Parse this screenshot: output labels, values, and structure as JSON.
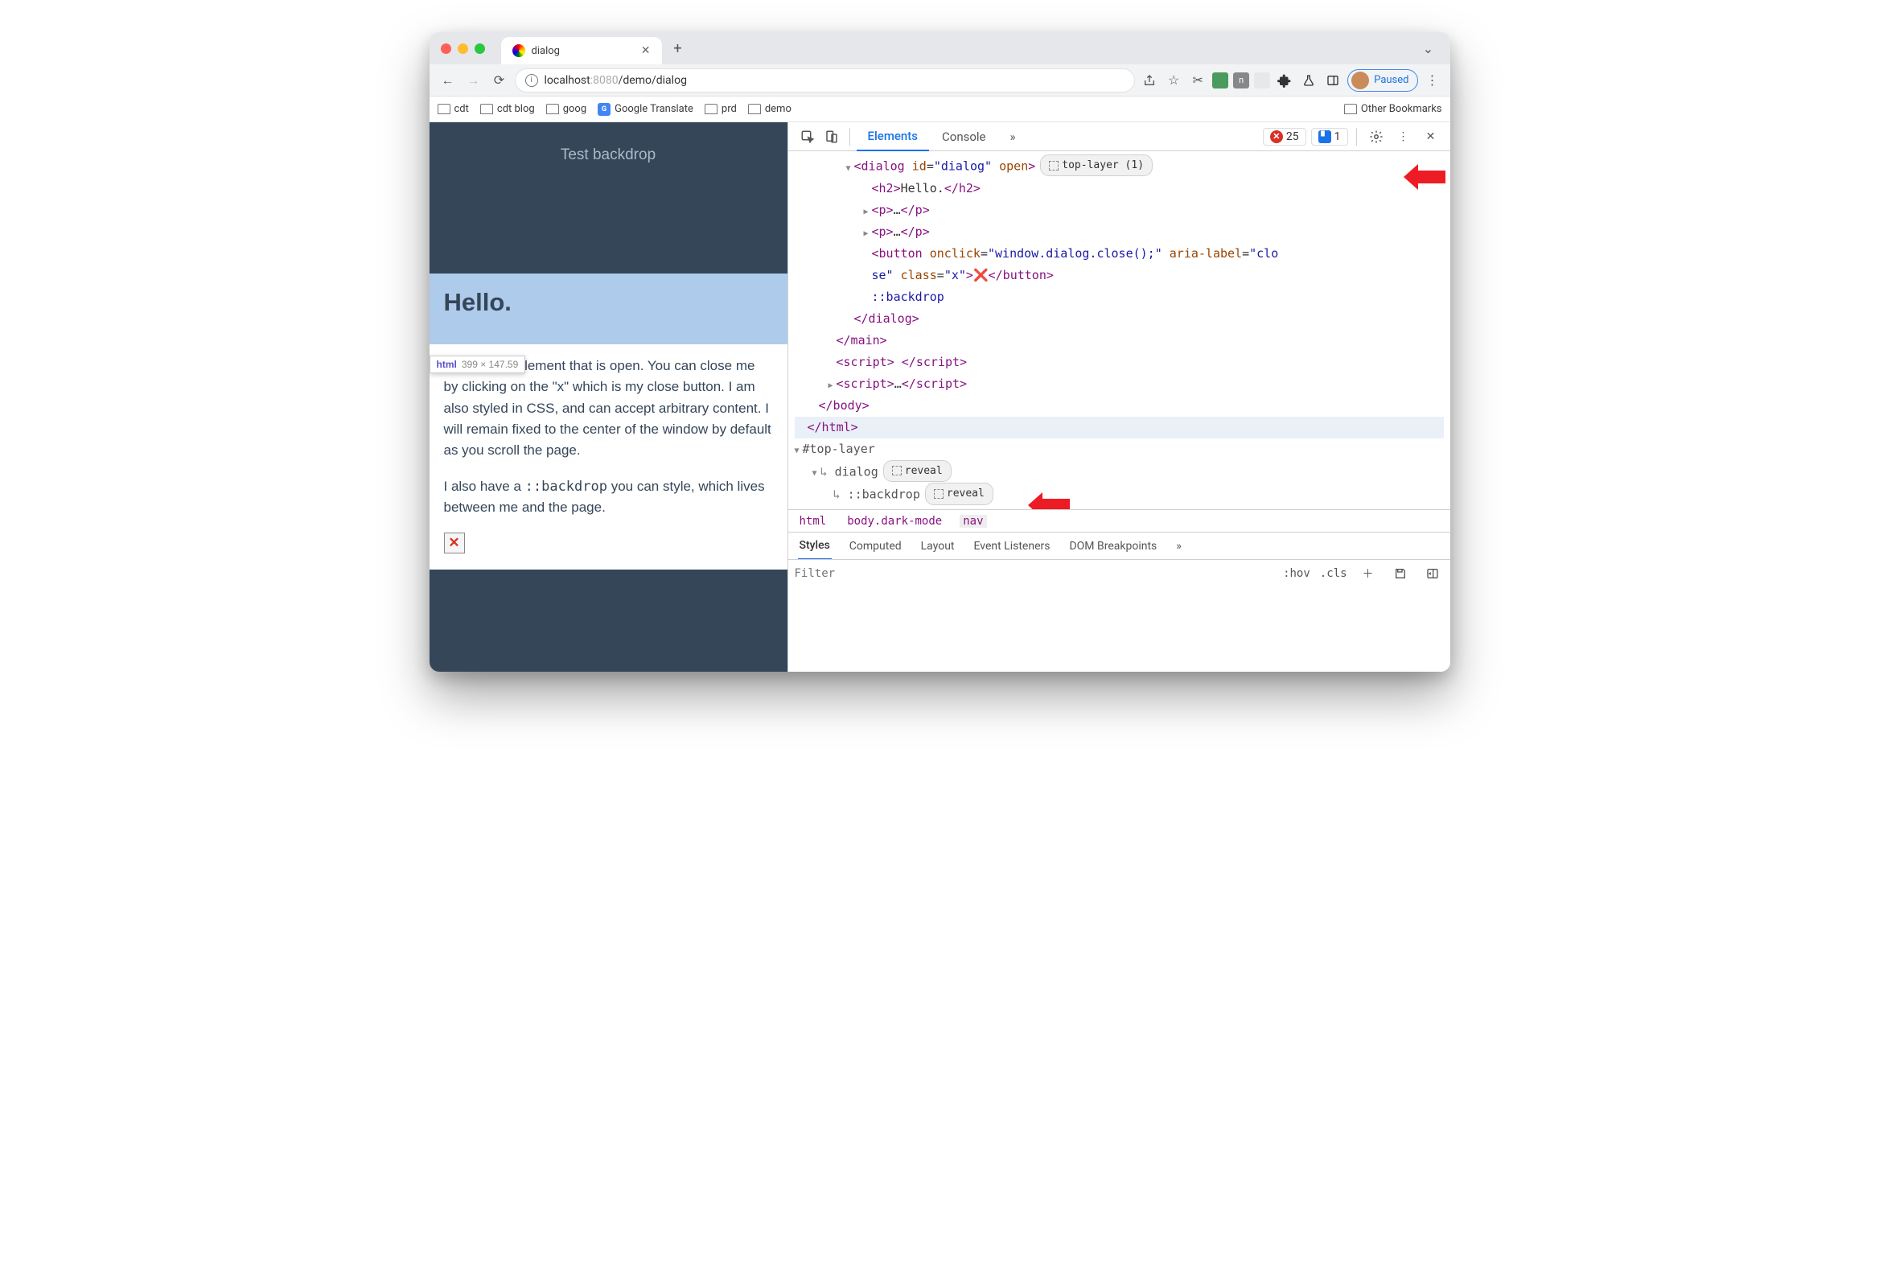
{
  "tab": {
    "title": "dialog"
  },
  "address": {
    "host_plain1": "localhost",
    "host_gray": ":8080",
    "path": "/demo/dialog"
  },
  "profile_label": "Paused",
  "bookmarks": {
    "items": [
      "cdt",
      "cdt blog",
      "goog",
      "Google Translate",
      "prd",
      "demo"
    ],
    "other": "Other Bookmarks"
  },
  "page": {
    "button": "Test backdrop",
    "heading": "Hello.",
    "tooltip_tag": "html",
    "tooltip_dim": "399 × 147.59",
    "para1": "I'm a dialog element that is open. You can close me by clicking on the \"x\" which is my close button. I am also styled in CSS, and can accept arbitrary content. I will remain fixed to the center of the window by default as you scroll the page.",
    "para2_a": "I also have a ",
    "para2_code": "::backdrop",
    "para2_b": " you can style, which lives between me and the page.",
    "xbtn": "✕"
  },
  "devtools": {
    "tabs": {
      "elements": "Elements",
      "console": "Console",
      "more": "»"
    },
    "err_count": "25",
    "info_count": "1",
    "tree": {
      "dialog_open": "<dialog id=\"dialog\" open>",
      "top_layer_badge": "top-layer (1)",
      "h2": "<h2>Hello.</h2>",
      "p_collapsed": "<p>…</p>",
      "button_line1": "<button onclick=\"window.dialog.close();\" aria-label=\"clo",
      "button_line2": "se\" class=\"x\">❌</button>",
      "backdrop": "::backdrop",
      "dialog_close": "</dialog>",
      "main_close": "</main>",
      "script_empty": "<script> </script>",
      "script_collapsed": "<script>…</script>",
      "body_close": "</body>",
      "html_close": "</html>",
      "top_layer": "#top-layer",
      "tl_dialog": "dialog",
      "tl_backdrop": "::backdrop",
      "reveal": "reveal"
    },
    "crumbs": [
      "html",
      "body.dark-mode",
      "nav"
    ],
    "styles_tabs": [
      "Styles",
      "Computed",
      "Layout",
      "Event Listeners",
      "DOM Breakpoints",
      "»"
    ],
    "filter_placeholder": "Filter",
    "hov": ":hov",
    "cls": ".cls"
  }
}
